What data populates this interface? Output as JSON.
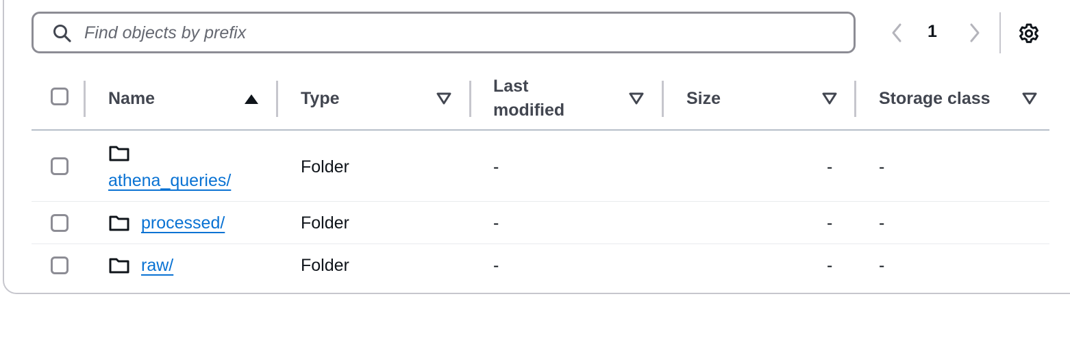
{
  "search": {
    "placeholder": "Find objects by prefix",
    "value": ""
  },
  "pagination": {
    "current_page": "1"
  },
  "table": {
    "headers": {
      "name": "Name",
      "type": "Type",
      "last_modified_line1": "Last",
      "last_modified_line2": "modified",
      "size": "Size",
      "storage_class": "Storage class"
    },
    "sort": {
      "column": "Name",
      "direction": "ascending"
    },
    "rows": [
      {
        "name": "athena_queries/",
        "type": "Folder",
        "last_modified": "-",
        "size": "-",
        "storage_class": "-",
        "icon": "folder-icon"
      },
      {
        "name": "processed/",
        "type": "Folder",
        "last_modified": "-",
        "size": "-",
        "storage_class": "-",
        "icon": "folder-icon"
      },
      {
        "name": "raw/",
        "type": "Folder",
        "last_modified": "-",
        "size": "-",
        "storage_class": "-",
        "icon": "folder-icon"
      }
    ]
  },
  "colors": {
    "link": "#0972d3",
    "border": "#8c8c94",
    "header_text": "#424650"
  }
}
